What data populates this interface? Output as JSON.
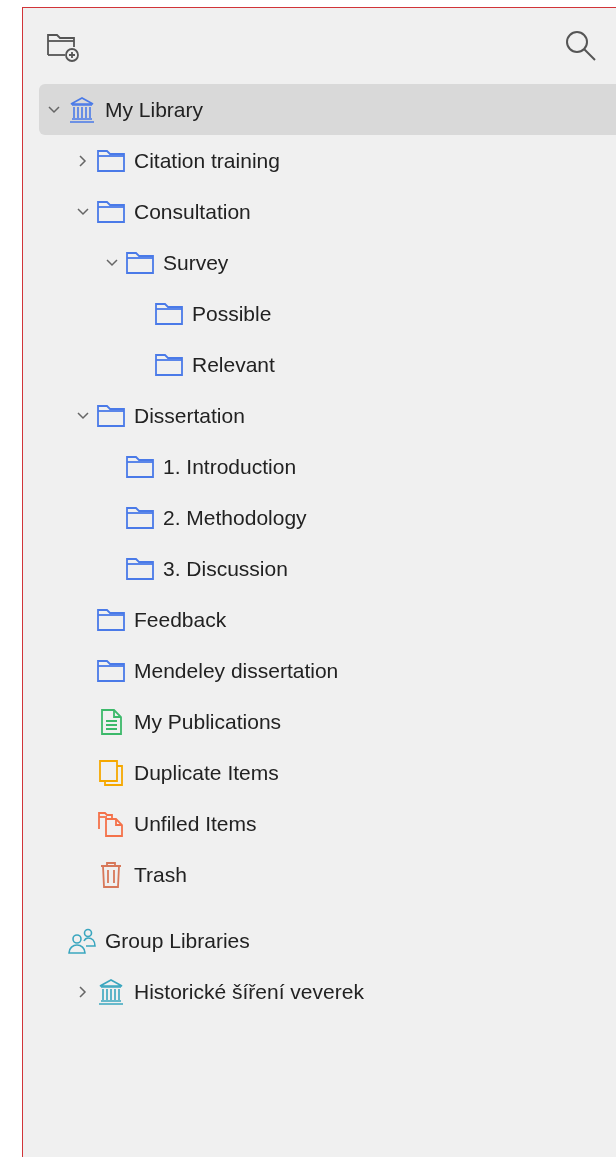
{
  "library": {
    "items": [
      {
        "kind": "library",
        "label": "My Library",
        "expanded": true,
        "selected": true,
        "children": [
          {
            "kind": "folder",
            "label": "Citation training",
            "expanded": false,
            "selected": false
          },
          {
            "kind": "folder",
            "label": "Consultation",
            "expanded": true,
            "selected": false,
            "children": [
              {
                "kind": "folder",
                "label": "Survey",
                "expanded": true,
                "selected": false,
                "children": [
                  {
                    "kind": "folder",
                    "label": "Possible",
                    "selected": false
                  },
                  {
                    "kind": "folder",
                    "label": "Relevant",
                    "selected": false
                  }
                ]
              }
            ]
          },
          {
            "kind": "folder",
            "label": "Dissertation",
            "expanded": true,
            "selected": false,
            "children": [
              {
                "kind": "folder",
                "label": "1. Introduction",
                "selected": false
              },
              {
                "kind": "folder",
                "label": "2. Methodology",
                "selected": false
              },
              {
                "kind": "folder",
                "label": "3. Discussion",
                "selected": false
              }
            ]
          },
          {
            "kind": "folder",
            "label": "Feedback",
            "selected": false
          },
          {
            "kind": "folder",
            "label": "Mendeley dissertation",
            "selected": false
          },
          {
            "kind": "publications",
            "label": "My Publications",
            "selected": false
          },
          {
            "kind": "duplicates",
            "label": "Duplicate Items",
            "selected": false
          },
          {
            "kind": "unfiled",
            "label": "Unfiled Items",
            "selected": false
          },
          {
            "kind": "trash",
            "label": "Trash",
            "selected": false
          }
        ]
      }
    ]
  },
  "groups": {
    "items": [
      {
        "kind": "groups",
        "label": "Group Libraries",
        "selected": false,
        "children": [
          {
            "kind": "group",
            "label": "Historické šíření veverek",
            "expanded": false,
            "selected": false
          }
        ]
      }
    ]
  }
}
